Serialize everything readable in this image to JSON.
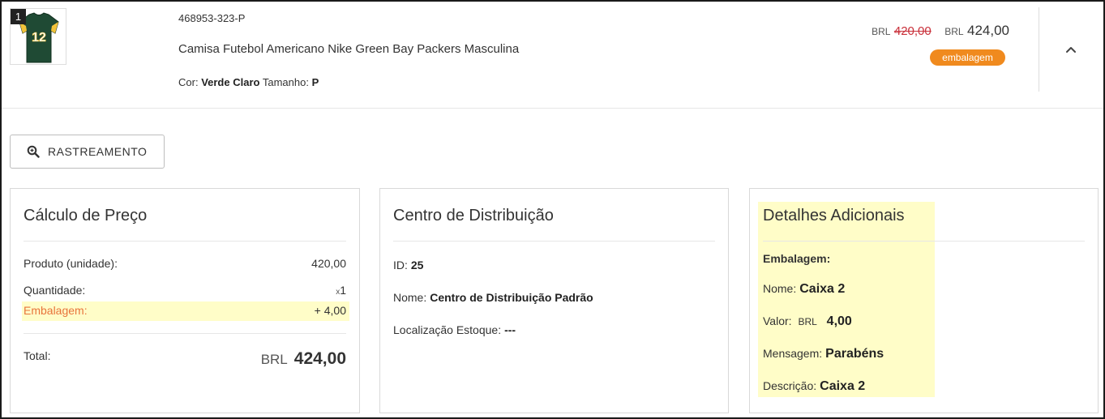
{
  "product": {
    "index": "1",
    "sku": "468953-323-P",
    "name": "Camisa Futebol Americano Nike Green Bay Packers Masculina",
    "color_label": "Cor:",
    "color_value": "Verde Claro",
    "size_label": "Tamanho:",
    "size_value": "P",
    "currency": "BRL",
    "old_price": "420,00",
    "new_price": "424,00",
    "badge": "embalagem",
    "jersey_number": "12"
  },
  "actions": {
    "tracking_label": "RASTREAMENTO"
  },
  "price_calc": {
    "title": "Cálculo de Preço",
    "unit_label": "Produto (unidade):",
    "unit_value": "420,00",
    "qty_label": "Quantidade:",
    "qty_prefix": "x",
    "qty_value": "1",
    "pkg_label": "Embalagem:",
    "pkg_value": "+ 4,00",
    "total_label": "Total:",
    "total_currency": "BRL",
    "total_value": "424,00"
  },
  "distribution": {
    "title": "Centro de Distribuição",
    "id_label": "ID:",
    "id_value": "25",
    "name_label": "Nome:",
    "name_value": "Centro de Distribuição Padrão",
    "stock_label": "Localização Estoque:",
    "stock_value": "---"
  },
  "extra": {
    "title": "Detalhes Adicionais",
    "section": "Embalagem:",
    "name_label": "Nome:",
    "name_value": "Caixa 2",
    "value_label": "Valor:",
    "value_currency": "BRL",
    "value_amount": "4,00",
    "message_label": "Mensagem:",
    "message_value": "Parabéns",
    "desc_label": "Descrição:",
    "desc_value": "Caixa 2"
  },
  "colors": {
    "accent_orange": "#f08a1e",
    "old_price_red": "#c9303a",
    "highlight_yellow": "#fffdc8",
    "label_orange": "#e8743b"
  },
  "icons": [
    "zoom-search-icon",
    "chevron-up-icon",
    "jersey-thumbnail"
  ]
}
